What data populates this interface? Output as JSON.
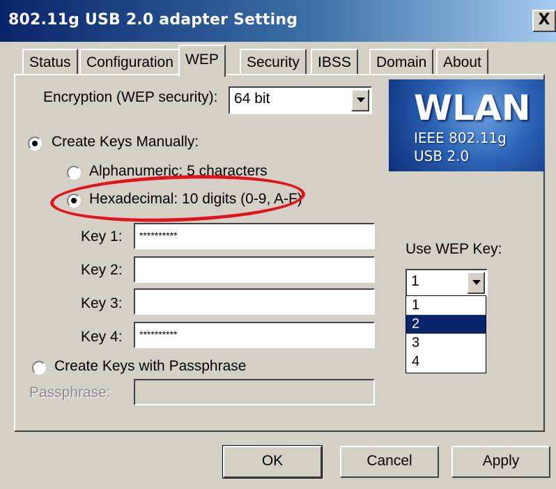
{
  "window": {
    "title": "802.11g USB 2.0 adapter Setting",
    "close_label": "X"
  },
  "tabs": [
    {
      "label": "Status"
    },
    {
      "label": "Configuration"
    },
    {
      "label": "WEP"
    },
    {
      "label": "Security"
    },
    {
      "label": "IBSS"
    },
    {
      "label": "Domain"
    },
    {
      "label": "About"
    }
  ],
  "encryption": {
    "label": "Encryption (WEP security):",
    "value": "64 bit"
  },
  "logo": {
    "title": "WLAN",
    "line1": "IEEE 802.11g",
    "line2": "USB 2.0"
  },
  "manual": {
    "label": "Create Keys Manually:",
    "alnum_label": "Alphanumeric: 5 characters",
    "hex_label": "Hexadecimal: 10 digits (0-9, A-F)"
  },
  "keys": [
    {
      "label": "Key 1:",
      "value": "**********"
    },
    {
      "label": "Key 2:",
      "value": ""
    },
    {
      "label": "Key 3:",
      "value": ""
    },
    {
      "label": "Key 4:",
      "value": "**********"
    }
  ],
  "wep_key": {
    "label": "Use WEP Key:",
    "value": "1",
    "options": [
      "1",
      "2",
      "3",
      "4"
    ],
    "highlighted": "2"
  },
  "passphrase": {
    "radio_label": "Create Keys with Passphrase",
    "label": "Passphrase:",
    "value": ""
  },
  "buttons": {
    "ok": "OK",
    "cancel": "Cancel",
    "apply": "Apply"
  },
  "colors": {
    "annotation_ellipse": "#e0141a",
    "title_bar": "#0a246a",
    "selection": "#0a246a"
  }
}
